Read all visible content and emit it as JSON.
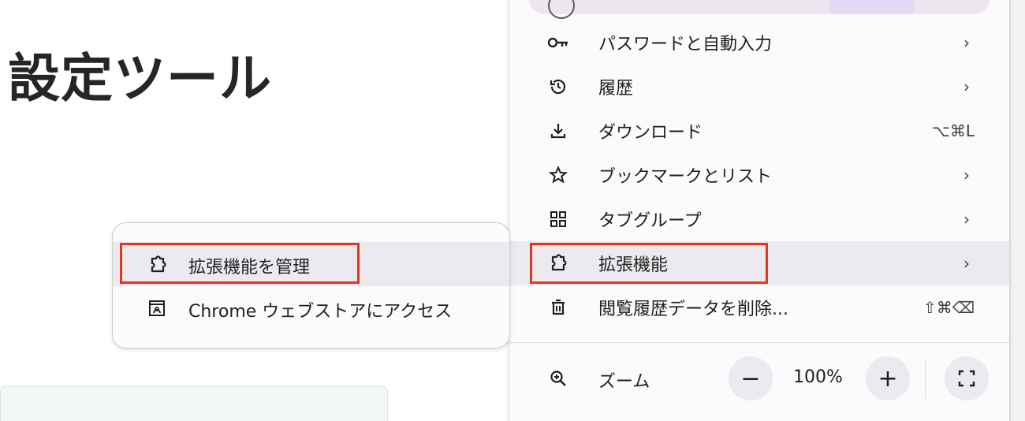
{
  "page": {
    "title": "設定ツール"
  },
  "menu": {
    "items": [
      {
        "label": "パスワードと自動入力",
        "right": "›",
        "icon": "key-icon"
      },
      {
        "label": "履歴",
        "right": "›",
        "icon": "history-icon"
      },
      {
        "label": "ダウンロード",
        "right": "⌥⌘L",
        "icon": "download-icon"
      },
      {
        "label": "ブックマークとリスト",
        "right": "›",
        "icon": "star-icon"
      },
      {
        "label": "タブグループ",
        "right": "›",
        "icon": "tab-groups-icon"
      },
      {
        "label": "拡張機能",
        "right": "›",
        "icon": "extension-icon"
      },
      {
        "label": "閲覧履歴データを削除...",
        "right": "⇧⌘⌫",
        "icon": "trash-icon"
      }
    ],
    "zoom": {
      "label": "ズーム",
      "minus": "−",
      "value": "100%",
      "plus": "+"
    }
  },
  "submenu": {
    "items": [
      {
        "label": "拡張機能を管理",
        "icon": "extension-icon"
      },
      {
        "label": "Chrome ウェブストアにアクセス",
        "icon": "web-store-icon"
      }
    ]
  },
  "colors": {
    "highlight_box": "#e8331c",
    "menu_bg": "#fcfafd",
    "hover_bg": "#ece9ef"
  }
}
